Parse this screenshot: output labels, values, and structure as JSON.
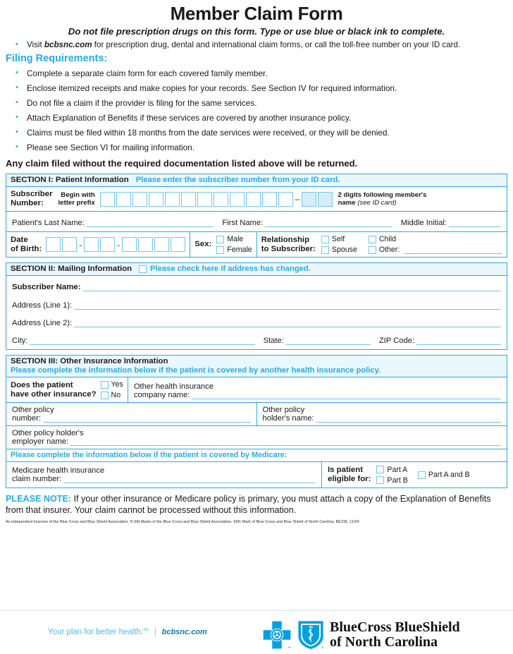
{
  "colors": {
    "accent": "#29ABE2",
    "rule": "#6fc6ea",
    "header_bg": "#eaf7fd",
    "shaded_box": "#d6eefa"
  },
  "header": {
    "title": "Member Claim Form",
    "subtitle": "Do not file prescription drugs on this form. Type or use blue or black ink to complete.",
    "visit_bullet_pre": "Visit ",
    "visit_bullet_site": "bcbsnc.com",
    "visit_bullet_post": " for prescription drug, dental and international claim forms, or call the toll-free number on your ID card.",
    "filing_requirements_label": "Filing Requirements:",
    "requirements": [
      "Complete a separate claim form for each covered family member.",
      "Enclose itemized receipts and make copies for your records. See Section IV for required information.",
      "Do not file a claim if the provider is filing for the same services.",
      "Attach Explanation of Benefits if these services are covered by another insurance policy.",
      "Claims must be filed within 18 months from the date services were received, or they will be denied.",
      "Please see Section VI for mailing information."
    ],
    "warning": "Any claim filed without the required documentation listed above will be returned."
  },
  "section1": {
    "heading": "SECTION I:  Patient Information",
    "note": "Please enter the subscriber number from your ID card.",
    "subscriber_number_label_line1": "Subscriber",
    "subscriber_number_label_line2": "Number:",
    "begin_prefix_line1": "Begin with",
    "begin_prefix_line2": "letter prefix",
    "boxes_main_count": 12,
    "boxes_shaded_count": 2,
    "separator": "–",
    "suffix_note_line1": "2 digits following member's",
    "suffix_note_line2_pre": "name ",
    "suffix_note_line2_em": "(see ID card)",
    "patient_last_name_label": "Patient's Last Name:",
    "first_name_label": "First Name:",
    "middle_initial_label": "Middle Initial:",
    "dob_label_line1": "Date",
    "dob_label_line2": "of Birth:",
    "dob_groups": [
      2,
      2,
      4
    ],
    "dob_separator": "-",
    "sex_label": "Sex:",
    "sex_options": [
      "Male",
      "Female"
    ],
    "relationship_label_line1": "Relationship",
    "relationship_label_line2": "to Subscriber:",
    "relationship_options": [
      "Self",
      "Spouse",
      "Child",
      "Other:"
    ]
  },
  "section2": {
    "heading": "SECTION II:  Mailing Information",
    "note": "Please check here if address has changed.",
    "fields": [
      {
        "label": "Subscriber Name:"
      },
      {
        "label": "Address (Line 1):"
      },
      {
        "label": "Address (Line 2):"
      }
    ],
    "city_label": "City:",
    "state_label": "State:",
    "zip_label": "ZIP Code:"
  },
  "section3": {
    "heading": "SECTION III:  Other Insurance Information",
    "note": "Please complete the information below if the patient is covered by another health insurance policy.",
    "has_other_label_line1": "Does the patient",
    "has_other_label_line2": "have other insurance?",
    "yes_no": [
      "Yes",
      "No"
    ],
    "company_label_line1": "Other health insurance",
    "company_label_line2": "company name:",
    "policy_number_line1": "Other policy",
    "policy_number_line2": "number:",
    "policy_holder_line1": "Other policy",
    "policy_holder_line2": "holder's name:",
    "employer_line1": "Other policy holder's",
    "employer_line2": "employer name:",
    "medicare_note": "Please complete the information below if the patient is covered by Medicare:",
    "medicare_claim_line1": "Medicare health insurance",
    "medicare_claim_line2": "claim number:",
    "eligible_label_line1": "Is patient",
    "eligible_label_line2": "eligible for:",
    "eligible_options": [
      "Part A",
      "Part B",
      "Part A and B"
    ]
  },
  "please_note": {
    "label": "PLEASE NOTE:",
    "text": " If your other insurance or Medicare policy is primary, you must attach a copy of the Explanation of Benefits from that insurer. Your claim cannot be processed without this information."
  },
  "fineprint": "An independent licensee of the Blue Cross and Blue Shield Association.  ®,SM Marks of the Blue Cross and Blue Shield Association.  SM1 Mark of Blue Cross and Blue Shield of North Carolina.  BE236,  11/09",
  "footer": {
    "tagline": "Your plan for better health.",
    "tagline_tm": "SM",
    "website": "bcbsnc.com",
    "brand_line1": "BlueCross BlueShield",
    "brand_line2": "of North Carolina"
  }
}
